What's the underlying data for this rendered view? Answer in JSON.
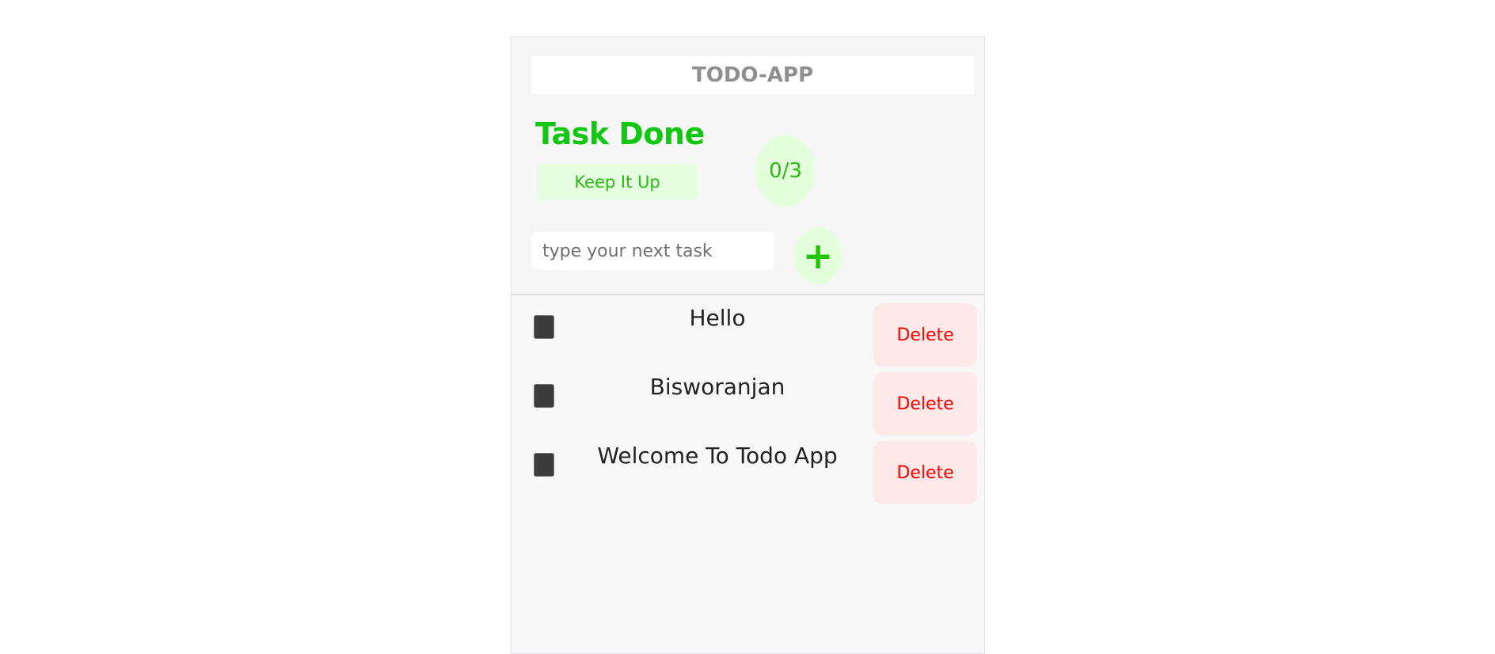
{
  "app": {
    "title": "TODO-APP"
  },
  "stats": {
    "heading": "Task Done",
    "message": "Keep It Up",
    "done": 0,
    "total": 3,
    "count_label": "0/3"
  },
  "new_task": {
    "placeholder": "type your next task",
    "value": "",
    "add_icon": "plus-icon",
    "add_label": "+"
  },
  "tasks": [
    {
      "text": "Hello",
      "done": false,
      "delete_label": "Delete"
    },
    {
      "text": "Bisworanjan",
      "done": false,
      "delete_label": "Delete"
    },
    {
      "text": "Welcome To Todo App",
      "done": false,
      "delete_label": "Delete"
    }
  ],
  "colors": {
    "accent": "#11c711",
    "delete": "#ff0000",
    "delete_bg": "#ffe8e8",
    "accent_bg": "#e3ffdc"
  }
}
